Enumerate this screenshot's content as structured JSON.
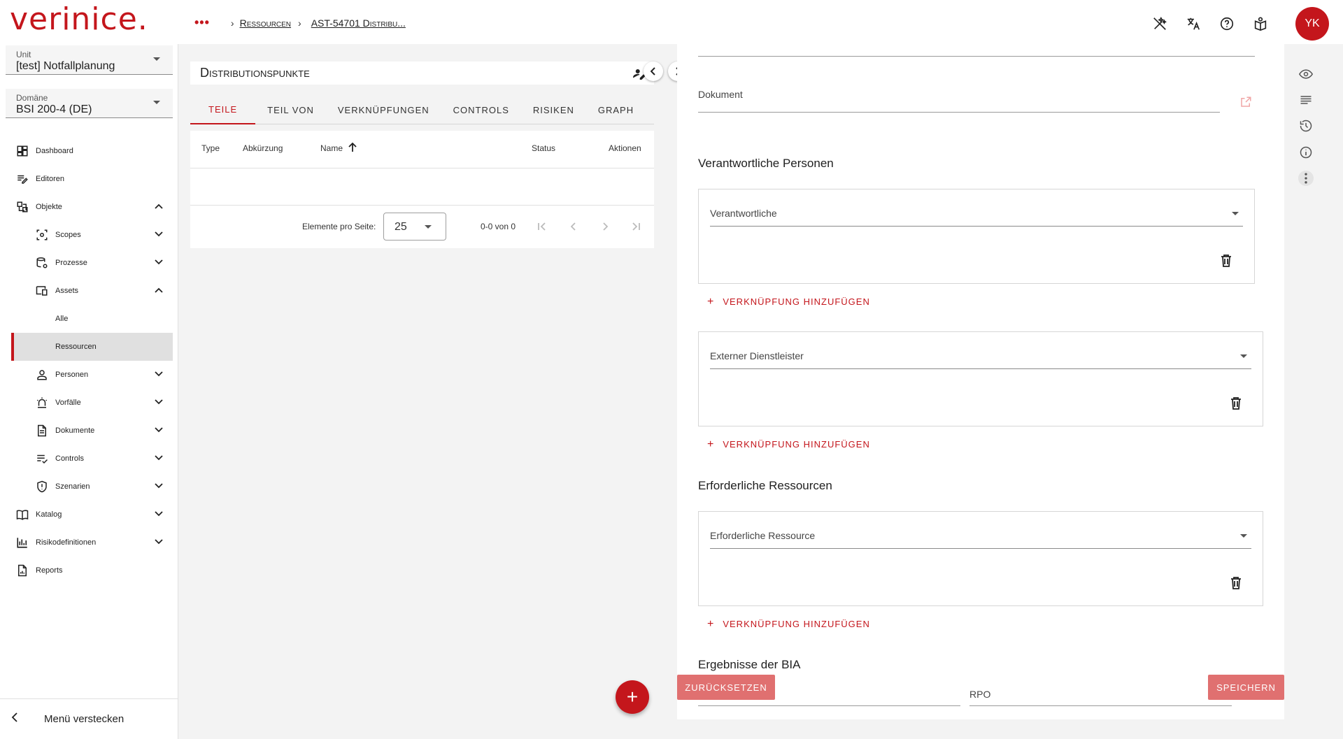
{
  "app": {
    "logo": "verinice."
  },
  "breadcrumb": {
    "dots": "•••",
    "items": [
      "Ressourcen",
      "AST-54701 Distribu..."
    ]
  },
  "header": {
    "user_initials": "YK"
  },
  "sidebar": {
    "unit": {
      "label": "Unit",
      "value": "[test] Notfallplanung"
    },
    "domain": {
      "label": "Domäne",
      "value": "BSI 200-4 (DE)"
    },
    "nav": [
      {
        "label": "Dashboard"
      },
      {
        "label": "Editoren"
      },
      {
        "label": "Objekte"
      },
      {
        "label": "Scopes"
      },
      {
        "label": "Prozesse"
      },
      {
        "label": "Assets"
      },
      {
        "label": "Alle"
      },
      {
        "label": "Ressourcen"
      },
      {
        "label": "Personen"
      },
      {
        "label": "Vorfälle"
      },
      {
        "label": "Dokumente"
      },
      {
        "label": "Controls"
      },
      {
        "label": "Szenarien"
      },
      {
        "label": "Katalog"
      },
      {
        "label": "Risikodefinitionen"
      },
      {
        "label": "Reports"
      }
    ],
    "hide_menu": "Menü verstecken"
  },
  "panel": {
    "title": "Distributionspunkte",
    "tabs": [
      "TEILE",
      "TEIL VON",
      "VERKNÜPFUNGEN",
      "CONTROLS",
      "RISIKEN",
      "GRAPH"
    ],
    "table": {
      "columns": [
        "Type",
        "Abkürzung",
        "Name",
        "Status",
        "Aktionen"
      ],
      "per_page_label": "Elemente pro Seite:",
      "per_page_value": "25",
      "range": "0-0 von 0"
    },
    "fab": "+"
  },
  "form": {
    "dokument_label": "Dokument",
    "section_persons": "Verantwortliche Personen",
    "field_verantwortliche": "Verantwortliche",
    "add_link": "VERKNÜPFUNG HINZUFÜGEN",
    "field_dienstleister": "Externer Dienstleister",
    "section_resources": "Erforderliche Ressourcen",
    "field_ressource": "Erforderliche Ressource",
    "section_bia": "Ergebnisse der BIA",
    "field_rpo": "RPO",
    "reset": "ZURÜCKSETZEN",
    "save": "SPEICHERN"
  },
  "colors": {
    "accent": "#c4161c",
    "button_disabled": "#e07070"
  }
}
